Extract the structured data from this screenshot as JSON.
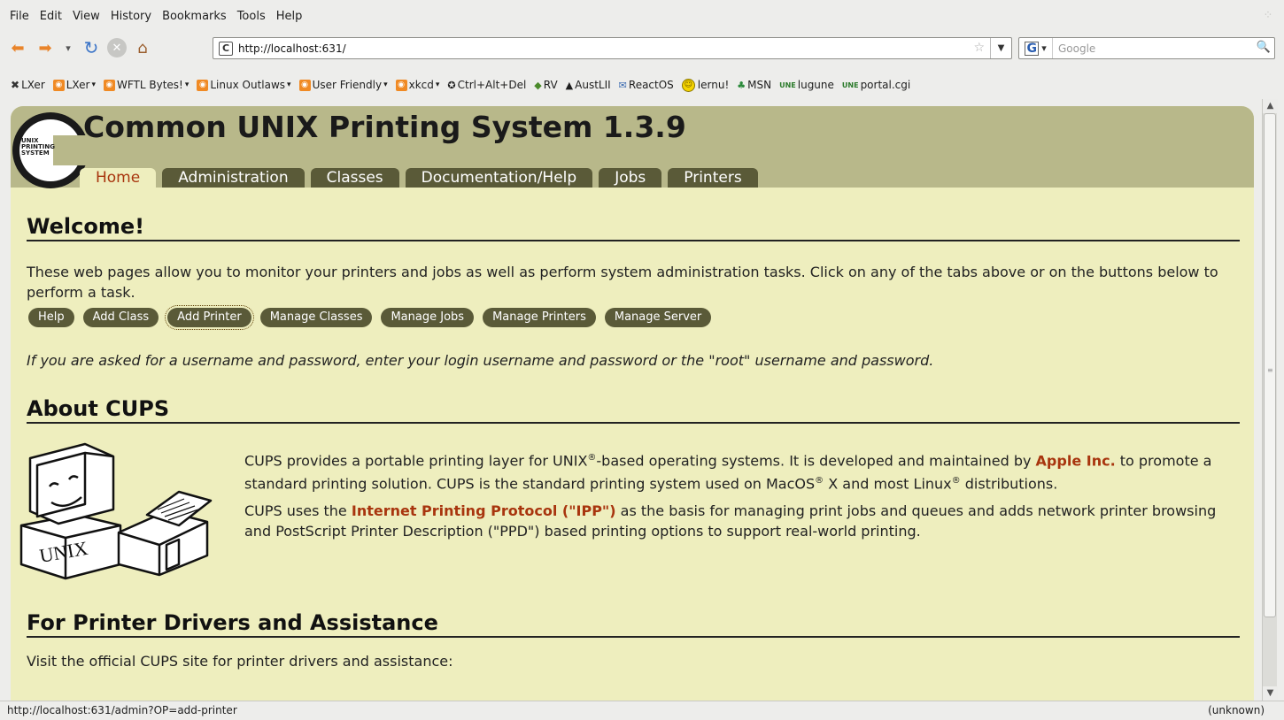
{
  "menu": [
    "File",
    "Edit",
    "View",
    "History",
    "Bookmarks",
    "Tools",
    "Help"
  ],
  "nav": {
    "url": "http://localhost:631/",
    "search_placeholder": "Google",
    "search_engine_letter": "G"
  },
  "bookmarks": [
    {
      "label": "LXer",
      "icon": "x-icon",
      "chevron": false
    },
    {
      "label": "LXer",
      "icon": "rss-icon",
      "chevron": true
    },
    {
      "label": "WFTL Bytes!",
      "icon": "rss-icon",
      "chevron": true
    },
    {
      "label": "Linux Outlaws",
      "icon": "rss-icon",
      "chevron": true
    },
    {
      "label": "User Friendly",
      "icon": "rss-icon",
      "chevron": true
    },
    {
      "label": "xkcd",
      "icon": "rss-icon",
      "chevron": true
    },
    {
      "label": "Ctrl+Alt+Del",
      "icon": "cad-icon",
      "chevron": false
    },
    {
      "label": "RV",
      "icon": "cube-icon",
      "chevron": false
    },
    {
      "label": "AustLII",
      "icon": "austlii-icon",
      "chevron": false
    },
    {
      "label": "ReactOS",
      "icon": "reactos-icon",
      "chevron": false
    },
    {
      "label": "lernu!",
      "icon": "smiley-icon",
      "chevron": false
    },
    {
      "label": "MSN",
      "icon": "msn-icon",
      "chevron": false
    },
    {
      "label": "lugune",
      "icon": "une-icon",
      "chevron": false
    },
    {
      "label": "portal.cgi",
      "icon": "une-icon",
      "chevron": false
    }
  ],
  "page": {
    "logo_lines": [
      "UNIX",
      "PRINTING",
      "SYSTEM"
    ],
    "title": "Common UNIX Printing System 1.3.9",
    "tabs": [
      "Home",
      "Administration",
      "Classes",
      "Documentation/Help",
      "Jobs",
      "Printers"
    ],
    "active_tab": "Home",
    "welcome": {
      "heading": "Welcome!",
      "text": "These web pages allow you to monitor your printers and jobs as well as perform system administration tasks. Click on any of the tabs above or on the buttons below to perform a task.",
      "buttons": [
        "Help",
        "Add Class",
        "Add Printer",
        "Manage Classes",
        "Manage Jobs",
        "Manage Printers",
        "Manage Server"
      ],
      "focused_button": "Add Printer",
      "note": "If you are asked for a username and password, enter your login username and password or the \"root\" username and password."
    },
    "about": {
      "heading": "About CUPS",
      "illustration_label": "UNIX",
      "p1_a": "CUPS provides a portable printing layer for UNIX",
      "p1_b": "-based operating systems. It is developed and maintained by ",
      "p1_link": "Apple Inc.",
      "p1_c": " to promote a standard printing solution. CUPS is the standard printing system used on MacOS",
      "p1_d": " X and most Linux",
      "p1_e": " distributions.",
      "reg": "®",
      "p2_a": "CUPS uses the ",
      "p2_link": "Internet Printing Protocol (\"IPP\")",
      "p2_b": " as the basis for managing print jobs and queues and adds network printer browsing and PostScript Printer Description (\"PPD\") based printing options to support real-world printing."
    },
    "drivers": {
      "heading": "For Printer Drivers and Assistance",
      "text": "Visit the official CUPS site for printer drivers and assistance:"
    }
  },
  "status": {
    "left": "http://localhost:631/admin?OP=add-printer",
    "right": "(unknown)"
  },
  "colors": {
    "page_bg": "#eeeebe",
    "header_bg": "#b8b88a",
    "tab_bg": "#5a5a38",
    "active_tab_text": "#a8350e",
    "link": "#a8350e"
  }
}
